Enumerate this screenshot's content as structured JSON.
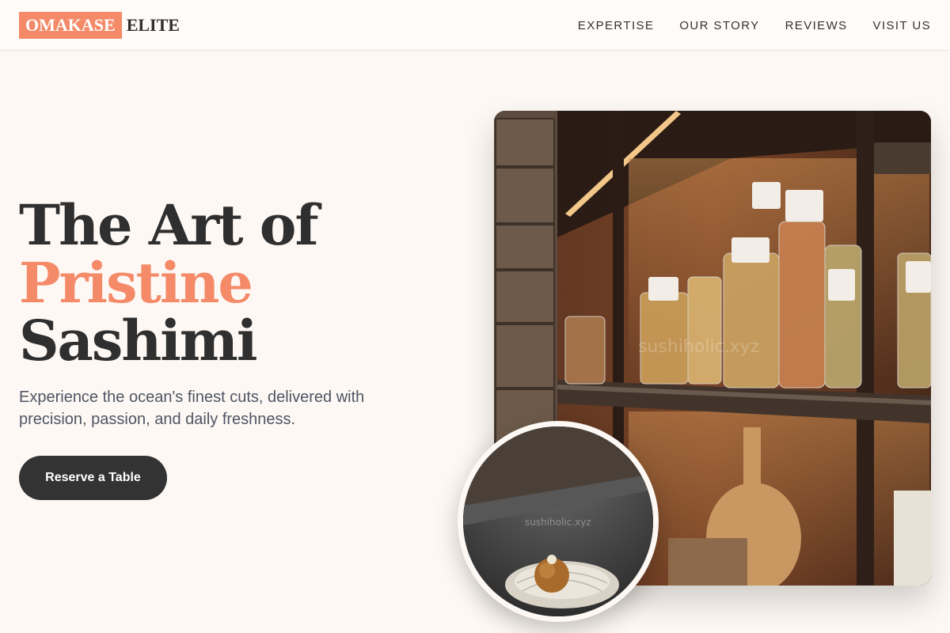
{
  "brand": {
    "logo_highlight": "OMAKASE",
    "logo_rest": "ELITE",
    "accent_color": "#f48a68"
  },
  "nav": {
    "items": [
      "EXPERTISE",
      "OUR STORY",
      "REVIEWS",
      "VISIT US"
    ]
  },
  "hero": {
    "title_line1": "The Art of",
    "title_line2": "Pristine",
    "title_line3": "Sashimi",
    "subtitle": "Experience the ocean's finest cuts, delivered with precision, passion, and daily freshness.",
    "cta_label": "Reserve a Table"
  },
  "images": {
    "main_watermark": "sushiholic.xyz",
    "circle_watermark": "sushiholic.xyz"
  }
}
